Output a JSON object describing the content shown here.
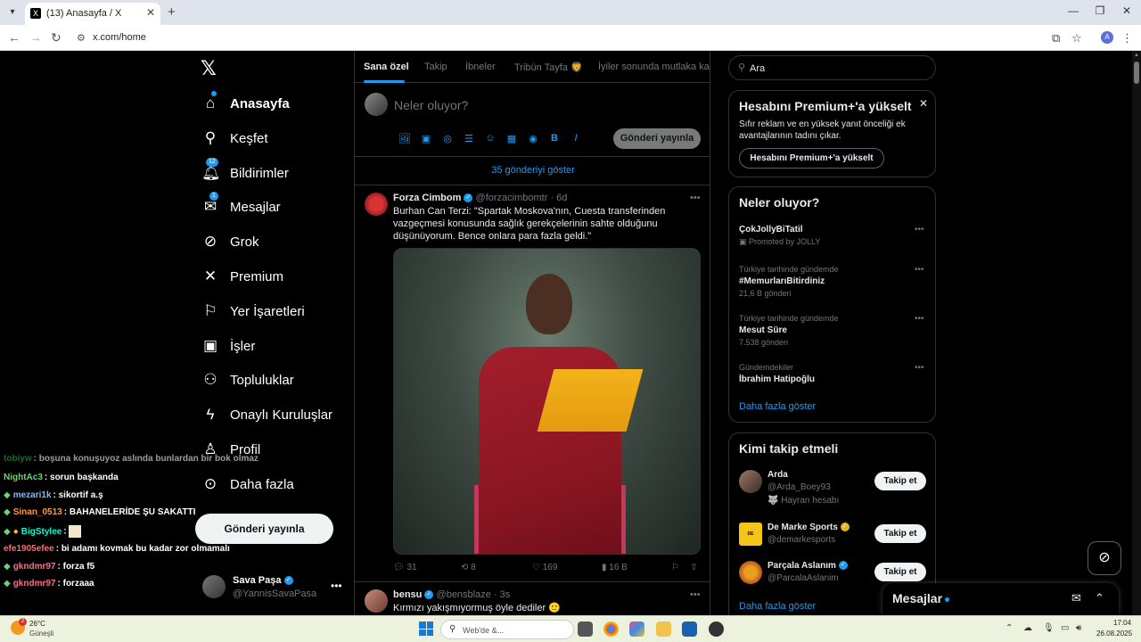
{
  "browser": {
    "tab_title": "(13) Anasayfa / X",
    "tab_favicon": "X",
    "close_tab": "✕",
    "new_tab": "+",
    "url": "x.com/home",
    "profile_initial": "A"
  },
  "sidebar": {
    "logo": "𝕏",
    "items": [
      {
        "label": "Anasayfa",
        "icon": "home-icon"
      },
      {
        "label": "Keşfet",
        "icon": "search-icon"
      },
      {
        "label": "Bildirimler",
        "icon": "bell-icon",
        "badge": "12"
      },
      {
        "label": "Mesajlar",
        "icon": "mail-icon",
        "badge": "1"
      },
      {
        "label": "Grok",
        "icon": "grok-icon"
      },
      {
        "label": "Premium",
        "icon": "x-icon"
      },
      {
        "label": "Yer İşaretleri",
        "icon": "bookmark-icon"
      },
      {
        "label": "İşler",
        "icon": "briefcase-icon"
      },
      {
        "label": "Topluluklar",
        "icon": "people-icon"
      },
      {
        "label": "Onaylı Kuruluşlar",
        "icon": "lightning-icon"
      },
      {
        "label": "Profil",
        "icon": "person-icon"
      },
      {
        "label": "Daha fazla",
        "icon": "more-circle-icon"
      }
    ],
    "post_button": "Gönderi yayınla",
    "user": {
      "name": "Sava Paşa",
      "handle": "@YannisSavaPasa"
    }
  },
  "chat": [
    {
      "user": "tobiyw",
      "msg": ": boşuna konuşuyoz aslında bunlardan bir bok olmaz",
      "color": "#3aa655"
    },
    {
      "user": "NightAc3",
      "msg": ": sorun başkanda",
      "color": "#6fd36f"
    },
    {
      "user": "mezari1k",
      "msg": ": sikortif a.ş",
      "color": "#7db9ff"
    },
    {
      "user": "Sinan_0513",
      "msg": ": BAHANELERİDE ŞU SAKATTI",
      "color": "#ff9a3c"
    },
    {
      "user": "BigStylee",
      "msg": ":",
      "color": "#00ffd0"
    },
    {
      "user": "efe1905efee",
      "msg": ": bi adamı kovmak bu kadar zor olmamalı",
      "color": "#ff6b6b"
    },
    {
      "user": "gkndmr97",
      "msg": ": forza f5",
      "color": "#ff6b8b"
    },
    {
      "user": "gkndmr97",
      "msg": ": forzaaa",
      "color": "#ff6b8b"
    }
  ],
  "feed": {
    "tabs": [
      "Sana özel",
      "Takip",
      "İbneler",
      "Tribün Tayfa 🦁",
      "İyiler sonunda mutlaka kaz"
    ],
    "compose_placeholder": "Neler oluyor?",
    "compose_post": "Gönderi yayınla",
    "compose_tools": [
      "🖼",
      "▣",
      "◎",
      "☰",
      "☺",
      "▦",
      "◉",
      "B",
      "I"
    ],
    "show_posts": "35 gönderiyi göster",
    "tweets": [
      {
        "name": "Forza Cimbom",
        "handle": "@forzacimbomtr",
        "time": "· 6d",
        "text": "Burhan Can Terzi: \"Spartak Moskova'nın, Cuesta transferinden vazgeçmesi konusunda sağlık gerekçelerinin sahte olduğunu düşünüyorum. Bence onlara para fazla geldi.\"",
        "replies": "31",
        "retweets": "8",
        "likes": "169",
        "views": "16 B"
      },
      {
        "name": "bensu",
        "handle": "@bensblaze",
        "time": "· 3s",
        "text": "Kırmızı yakışmıyormuş öyle dediler 🙂"
      }
    ]
  },
  "right": {
    "search_placeholder": "Ara",
    "premium": {
      "title": "Hesabını Premium+'a yükselt",
      "desc": "Sıfır reklam ve en yüksek yanıt önceliği ek avantajlarının tadını çıkar.",
      "button": "Hesabını Premium+'a yükselt"
    },
    "trends": {
      "title": "Neler oluyor?",
      "items": [
        {
          "cat": "",
          "name": "ÇokJollyBiTatil",
          "count": "Promoted by JOLLY"
        },
        {
          "cat": "Türkiye tarihinde gündemde",
          "name": "#MemurlarıBitirdiniz",
          "count": "21,6 B gönderi"
        },
        {
          "cat": "Türkiye tarihinde gündemde",
          "name": "Mesut Süre",
          "count": "7.538 gönderi"
        },
        {
          "cat": "Gündemdekiler",
          "name": "İbrahim Hatipoğlu",
          "count": ""
        }
      ],
      "more": "Daha fazla göster"
    },
    "who_to_follow": {
      "title": "Kimi takip etmeli",
      "items": [
        {
          "name": "Arda",
          "handle": "@Arda_Boey93",
          "extra": "🐺 Hayran hesabı",
          "button": "Takip et"
        },
        {
          "name": "De Marke Sports",
          "handle": "@demarkesports",
          "extra": "",
          "button": "Takip et"
        },
        {
          "name": "Parçala Aslanım",
          "handle": "@ParcalaAslanim",
          "extra": "",
          "button": "Takip et"
        }
      ],
      "more": "Daha fazla göster"
    }
  },
  "messages_drawer": {
    "title": "Mesajlar"
  },
  "taskbar": {
    "weather_temp": "26°C",
    "weather_desc": "Güneşli",
    "weather_badge": "2",
    "search_placeholder": "Web'de &...",
    "time": "17:04",
    "date": "26.08.2025"
  }
}
